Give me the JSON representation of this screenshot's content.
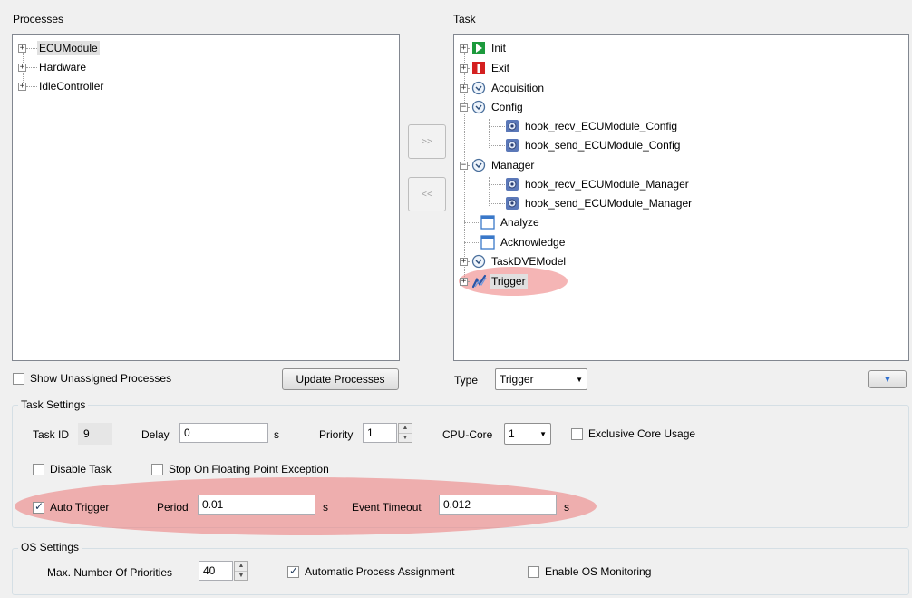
{
  "processes": {
    "title": "Processes",
    "items": [
      "ECUModule",
      "Hardware",
      "IdleController"
    ],
    "show_unassigned_label": "Show Unassigned Processes",
    "update_button": "Update Processes"
  },
  "task": {
    "title": "Task",
    "items": [
      {
        "label": "Init",
        "icon": "init-icon"
      },
      {
        "label": "Exit",
        "icon": "exit-icon"
      },
      {
        "label": "Acquisition",
        "icon": "clock-icon"
      },
      {
        "label": "Config",
        "icon": "clock-icon"
      },
      {
        "label": "hook_recv_ECUModule_Config",
        "icon": "hook-icon"
      },
      {
        "label": "hook_send_ECUModule_Config",
        "icon": "hook-icon"
      },
      {
        "label": "Manager",
        "icon": "clock-icon"
      },
      {
        "label": "hook_recv_ECUModule_Manager",
        "icon": "hook-icon"
      },
      {
        "label": "hook_send_ECUModule_Manager",
        "icon": "hook-icon"
      },
      {
        "label": "Analyze",
        "icon": "window-icon"
      },
      {
        "label": "Acknowledge",
        "icon": "window-icon"
      },
      {
        "label": "TaskDVEModel",
        "icon": "clock-icon"
      },
      {
        "label": "Trigger",
        "icon": "trigger-icon"
      }
    ],
    "type_label": "Type",
    "type_value": "Trigger"
  },
  "transfer": {
    "add": ">>",
    "remove": "<<"
  },
  "task_settings": {
    "title": "Task Settings",
    "task_id_label": "Task ID",
    "task_id_value": "9",
    "delay_label": "Delay",
    "delay_value": "0",
    "delay_unit": "s",
    "priority_label": "Priority",
    "priority_value": "1",
    "cpu_core_label": "CPU-Core",
    "cpu_core_value": "1",
    "exclusive_label": "Exclusive Core Usage",
    "disable_label": "Disable Task",
    "stop_fp_label": "Stop On Floating Point Exception",
    "auto_trigger_label": "Auto Trigger",
    "period_label": "Period",
    "period_value": "0.01",
    "period_unit": "s",
    "event_timeout_label": "Event Timeout",
    "event_timeout_value": "0.012",
    "event_timeout_unit": "s"
  },
  "os_settings": {
    "title": "OS Settings",
    "max_prio_label": "Max. Number Of Priorities",
    "max_prio_value": "40",
    "auto_assign_label": "Automatic Process Assignment",
    "os_monitoring_label": "Enable OS Monitoring"
  },
  "colors": {
    "highlight": "#ec7878",
    "accent": "#3a6fc4"
  }
}
